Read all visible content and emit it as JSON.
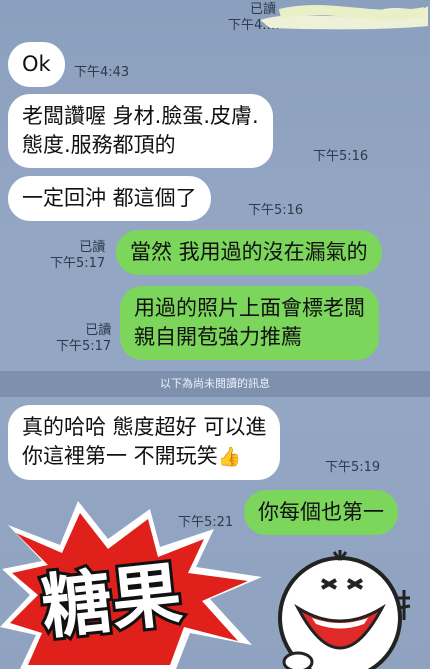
{
  "messages": [
    {
      "id": "m0",
      "side": "out",
      "read": "已讀",
      "time": "下午4:…"
    },
    {
      "id": "m1",
      "side": "in",
      "lines": [
        "Ok"
      ],
      "time": "下午4:43"
    },
    {
      "id": "m2",
      "side": "in",
      "lines": [
        "老闆讚喔 身材.臉蛋.皮膚.",
        "態度.服務都頂的"
      ],
      "time": "下午5:16"
    },
    {
      "id": "m3",
      "side": "in",
      "lines": [
        "一定回沖 都這個了"
      ],
      "time": "下午5:16"
    },
    {
      "id": "m4",
      "side": "out",
      "lines": [
        "當然 我用過的沒在漏氣的"
      ],
      "read": "已讀",
      "time": "下午5:17"
    },
    {
      "id": "m5",
      "side": "out",
      "lines": [
        "用過的照片上面會標老闆",
        "親自開苞強力推薦"
      ],
      "read": "已讀",
      "time": "下午5:17"
    },
    {
      "id": "m6",
      "side": "in",
      "lines": [
        "真的哈哈 態度超好 可以進",
        "你這裡第一 不開玩笑"
      ],
      "time": "下午5:19"
    },
    {
      "id": "m7",
      "side": "out",
      "lines": [
        "你每個也第一"
      ],
      "time": "下午5:21"
    }
  ],
  "divider": "以下為尚未閱讀的訊息",
  "thumb_emoji": "👍",
  "sticker_text": "糖果",
  "colors": {
    "bg": "#93a6c3",
    "incoming": "#ffffff",
    "outgoing": "#7bd65b",
    "burst": "#e0201b"
  }
}
